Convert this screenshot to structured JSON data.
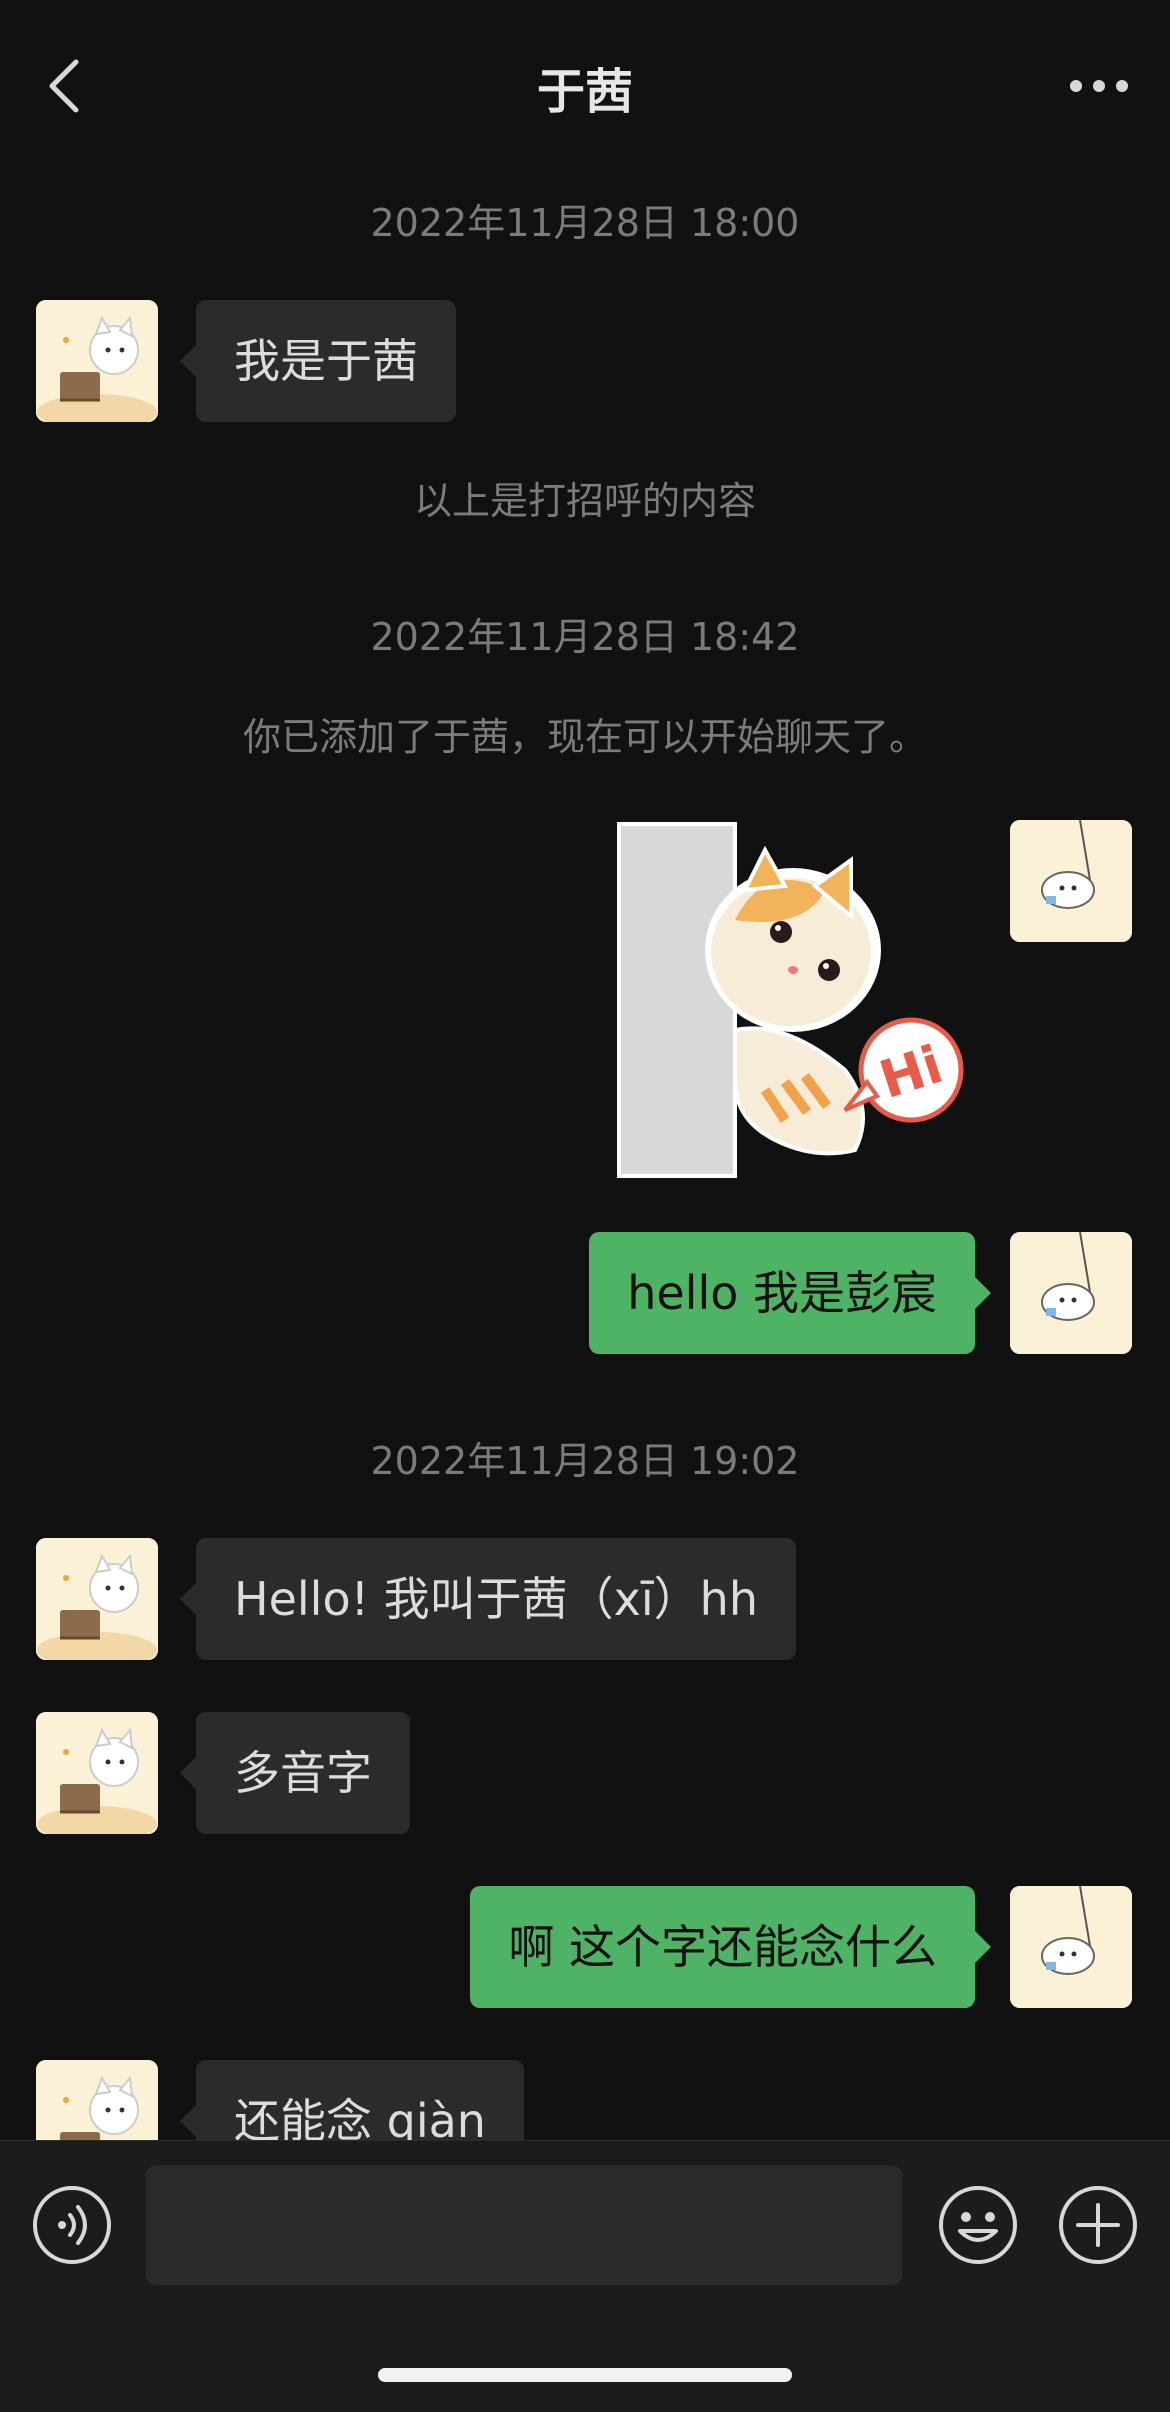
{
  "header": {
    "title": "于茜"
  },
  "messages": {
    "ts1": "2022年11月28日 18:00",
    "m1": "我是于茜",
    "sys1": "以上是打招呼的内容",
    "ts2": "2022年11月28日 18:42",
    "sys2": "你已添加了于茜，现在可以开始聊天了。",
    "sticker_text": "Hi",
    "m2": "hello 我是彭宸",
    "ts3": "2022年11月28日 19:02",
    "m3": "Hello! 我叫于茜（xī）hh",
    "m4": "多音字",
    "m5": "啊 这个字还能念什么",
    "m6": "还能念 qiàn"
  },
  "input": {
    "placeholder": ""
  },
  "icons": {
    "back": "chevron-left-icon",
    "more": "more-dots-icon",
    "voice": "voice-icon",
    "emoji": "emoji-icon",
    "plus": "plus-icon"
  },
  "colors": {
    "background": "#111111",
    "bubble_in": "#2b2b2b",
    "bubble_out": "#4fb365"
  }
}
